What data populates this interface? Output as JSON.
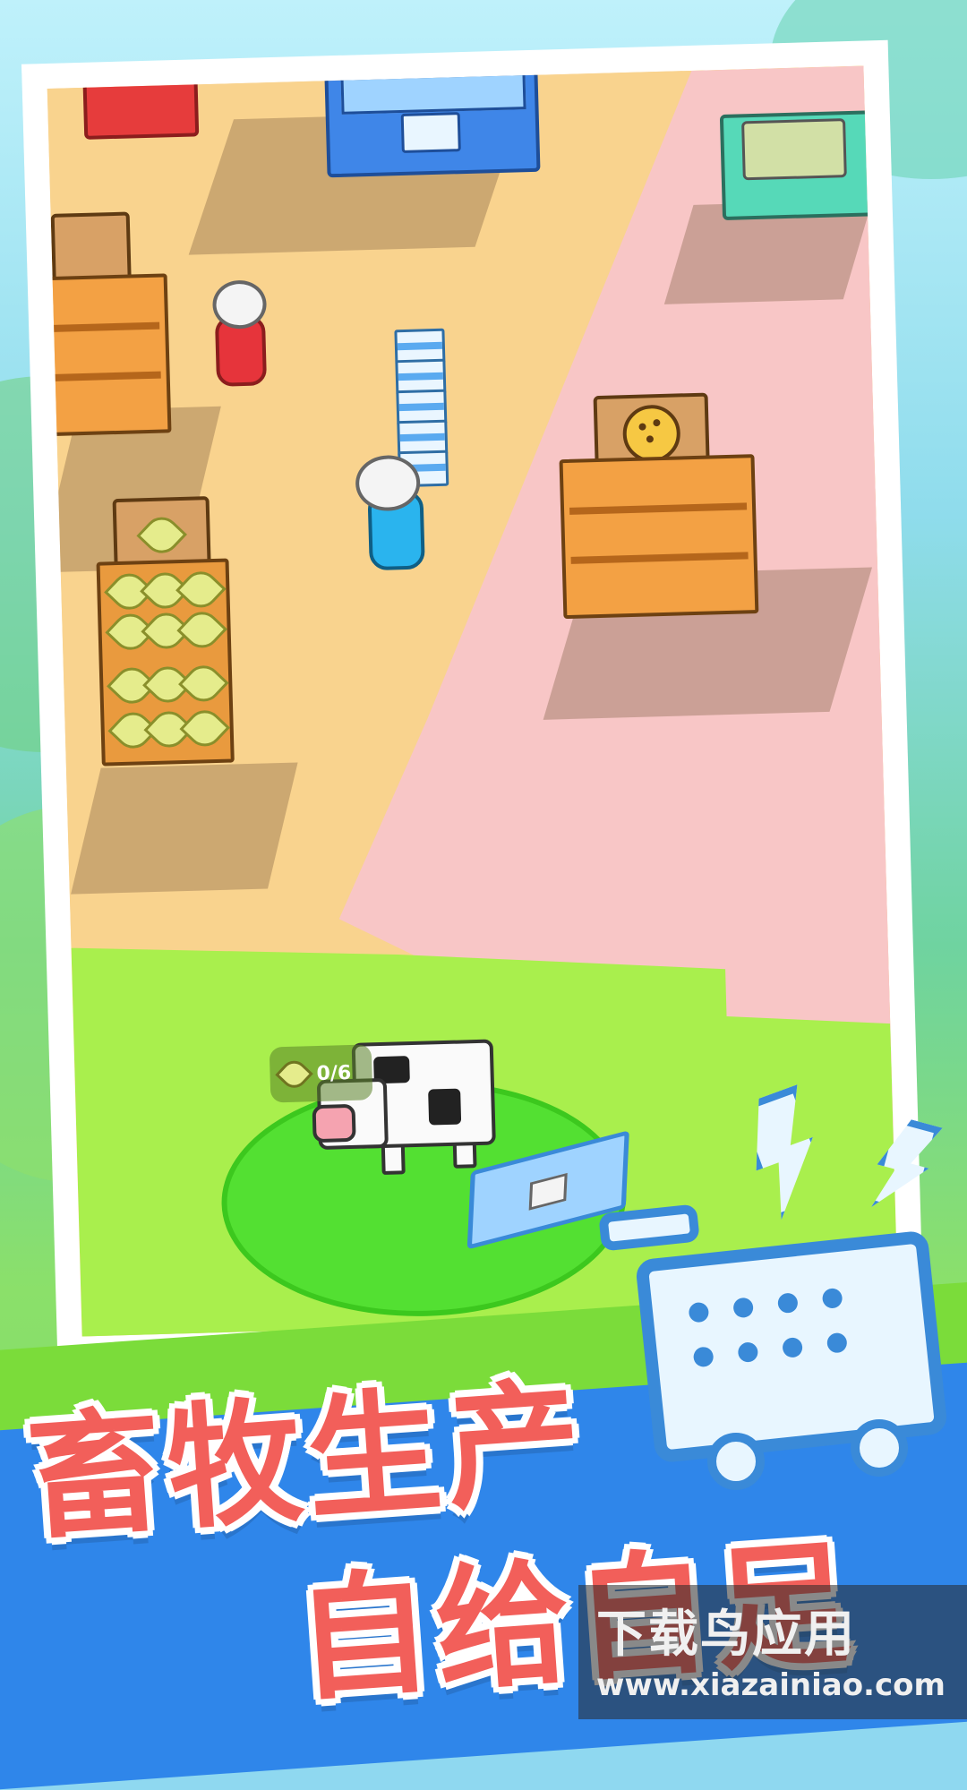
{
  "hud": {
    "wheat_counter": "0/6"
  },
  "banner": {
    "line1": "畜牧生产",
    "line2": "自给自足"
  },
  "watermark": {
    "title": "下载鸟应用",
    "url": "www.xiazainiao.com"
  },
  "colors": {
    "title_red": "#f25f5a",
    "band_blue": "#2f86ea",
    "band_green": "#7bdc3a",
    "player_blue": "#2ab4ee",
    "npc_red": "#e6343b",
    "pasture_green": "#53e032"
  },
  "icons": [
    "wheat-icon",
    "shopping-cart-icon",
    "lightning-bolt-icon"
  ]
}
